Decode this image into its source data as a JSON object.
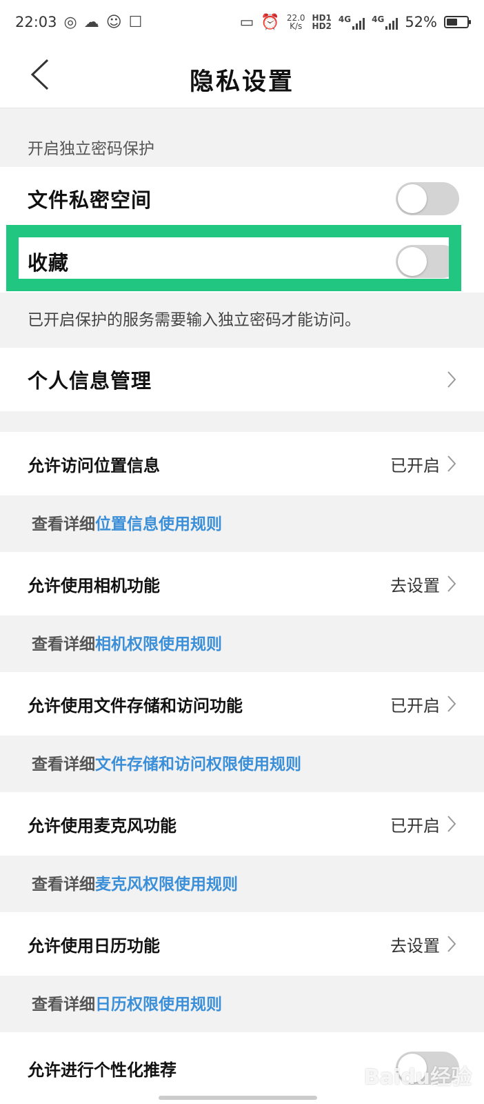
{
  "status_bar": {
    "time": "22:03",
    "speed_value": "22.0",
    "speed_unit": "K/s",
    "hd1": "HD1",
    "hd2": "HD2",
    "net1": "4G",
    "net2": "4G",
    "battery_percent": "52%",
    "battery_level": 0.52
  },
  "header": {
    "title": "隐私设置"
  },
  "password_section": {
    "label": "开启独立密码保护",
    "items": [
      {
        "label": "文件私密空间",
        "enabled": false
      },
      {
        "label": "收藏",
        "enabled": false
      }
    ],
    "note": "已开启保护的服务需要输入独立密码才能访问。"
  },
  "personal_info": {
    "label": "个人信息管理"
  },
  "permissions": [
    {
      "label": "允许访问位置信息",
      "status": "已开启",
      "detail_prefix": "查看详细",
      "detail_link": "位置信息使用规则"
    },
    {
      "label": "允许使用相机功能",
      "status": "去设置",
      "detail_prefix": "查看详细",
      "detail_link": "相机权限使用规则"
    },
    {
      "label": "允许使用文件存储和访问功能",
      "status": "已开启",
      "detail_prefix": "查看详细",
      "detail_link": "文件存储和访问权限使用规则"
    },
    {
      "label": "允许使用麦克风功能",
      "status": "已开启",
      "detail_prefix": "查看详细",
      "detail_link": "麦克风权限使用规则"
    },
    {
      "label": "允许使用日历功能",
      "status": "去设置",
      "detail_prefix": "查看详细",
      "detail_link": "日历权限使用规则"
    }
  ],
  "personalized": {
    "label": "允许进行个性化推荐"
  },
  "watermark": "Baidu经验",
  "colors": {
    "highlight": "#21c680",
    "link": "#3a8fd8",
    "toggle_off": "#d4d4d4"
  }
}
